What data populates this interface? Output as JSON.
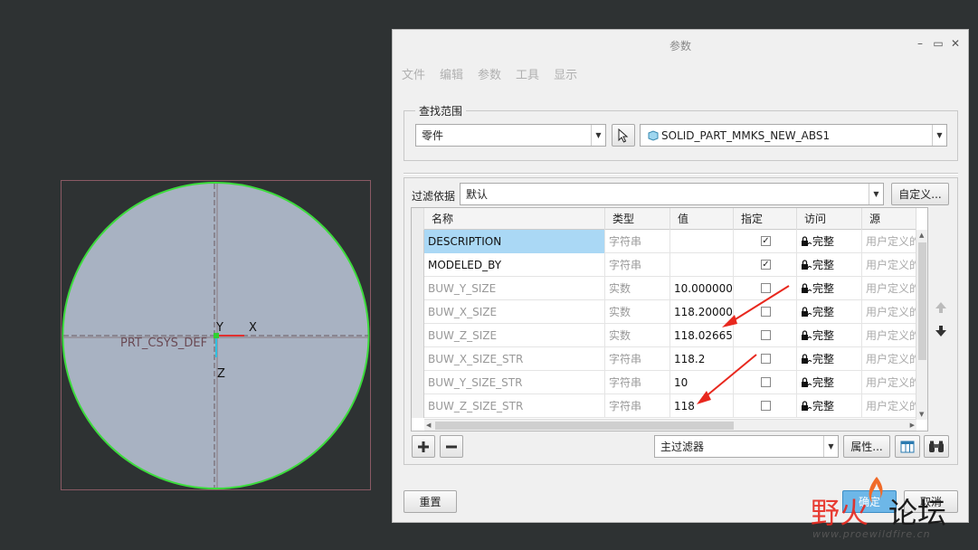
{
  "viewport": {
    "axis_y": "Y",
    "axis_x": "X",
    "axis_z": "Z",
    "csys_label": "PRT_CSYS_DEF"
  },
  "dialog": {
    "title": "参数",
    "menu": [
      "文件",
      "编辑",
      "参数",
      "工具",
      "显示"
    ],
    "scope": {
      "legend": "查找范围",
      "type_value": "零件",
      "object_value": "SOLID_PART_MMKS_NEW_ABS1"
    },
    "filter": {
      "label": "过滤依据",
      "value": "默认",
      "custom_button": "自定义..."
    },
    "table": {
      "headers": [
        "名称",
        "类型",
        "值",
        "指定",
        "访问",
        "源"
      ],
      "rows": [
        {
          "name": "DESCRIPTION",
          "type": "字符串",
          "value": "",
          "designated": true,
          "access": "完整",
          "source": "用户定义的"
        },
        {
          "name": "MODELED_BY",
          "type": "字符串",
          "value": "",
          "designated": true,
          "access": "完整",
          "source": "用户定义的"
        },
        {
          "name": "BUW_Y_SIZE",
          "type": "实数",
          "value": "10.000000",
          "designated": false,
          "access": "完整",
          "source": "用户定义的"
        },
        {
          "name": "BUW_X_SIZE",
          "type": "实数",
          "value": "118.200000",
          "designated": false,
          "access": "完整",
          "source": "用户定义的"
        },
        {
          "name": "BUW_Z_SIZE",
          "type": "实数",
          "value": "118.026650",
          "designated": false,
          "access": "完整",
          "source": "用户定义的"
        },
        {
          "name": "BUW_X_SIZE_STR",
          "type": "字符串",
          "value": "118.2",
          "designated": false,
          "access": "完整",
          "source": "用户定义的"
        },
        {
          "name": "BUW_Y_SIZE_STR",
          "type": "字符串",
          "value": "10",
          "designated": false,
          "access": "完整",
          "source": "用户定义的"
        },
        {
          "name": "BUW_Z_SIZE_STR",
          "type": "字符串",
          "value": "118",
          "designated": false,
          "access": "完整",
          "source": "用户定义的"
        }
      ]
    },
    "bottom": {
      "main_filter": "主过滤器",
      "properties_button": "属性..."
    },
    "footer": {
      "reset_button": "重置",
      "ok_button": "确定",
      "cancel_button": "取消"
    }
  },
  "watermark": {
    "text_red": "野火",
    "text_dark": "论坛",
    "url": "www.proewildfire.cn"
  },
  "colors": {
    "background": "#2e3233",
    "part_fill": "#a8b2c2",
    "part_edge": "#3cdc3c",
    "selection_blue": "#aad8f5",
    "arrow_red": "#e8281e"
  }
}
